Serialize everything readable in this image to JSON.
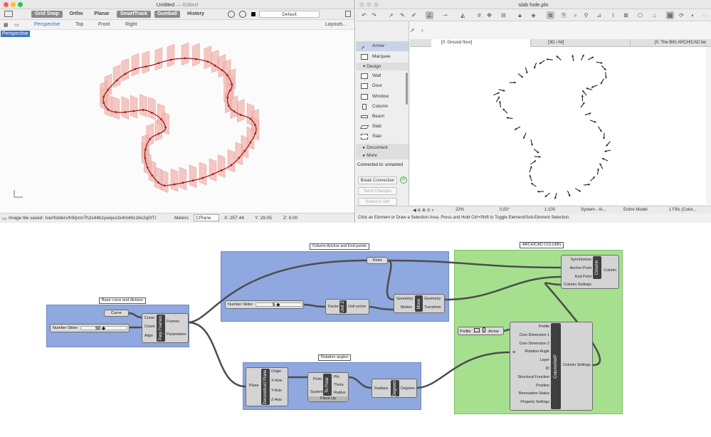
{
  "rhino": {
    "title": "Untitled",
    "title_status": "— Edited",
    "toolbar": {
      "grid_snap": "Grid Snap",
      "ortho": "Ortho",
      "planar": "Planar",
      "smarttrack": "SmartTrack",
      "gumball": "Gumball",
      "history": "History",
      "layer_default": "Default"
    },
    "tabs": [
      "Perspective",
      "Top",
      "Front",
      "Right"
    ],
    "layouts": "Layouts...",
    "viewport_label": "Perspective",
    "status": {
      "message": "Image tile saved: /var/folders/h9/prnr7h2x44b1ywqxs3x4m40c16v2q0/T/",
      "units": "Meters",
      "cplane": "CPlane",
      "x": "X: 257.44",
      "y": "Y: 29.05",
      "z": "Z: 0.00"
    }
  },
  "archicad": {
    "title": "slab hole.pln",
    "toolbox": {
      "items_top": [
        "Arrow",
        "Marquee"
      ],
      "design_header": "Design",
      "design_items": [
        "Wall",
        "Door",
        "Window",
        "Column",
        "Beam",
        "Slab",
        "Stair"
      ],
      "document_header": "Document",
      "more_header": "More"
    },
    "connection": {
      "status": "Connected to: unnamed",
      "break": "Break Connection",
      "send": "Send Changes",
      "select": "Select in GH"
    },
    "tabs": [
      "[0. Ground floor]",
      "[3D / All]",
      "[0. The BIG ARCHICAD template (The Bi..."
    ],
    "bottom": {
      "zoom": "22%",
      "angle": "0,00°",
      "scale": "1:100",
      "layer": "System - Al...",
      "model": "Entire Model",
      "fills": "1 Fills (Color..."
    },
    "status": "Click an Element or Draw a Selection Area. Press and Hold Ctrl+Shift to Toggle Element/Sub-Element Selection."
  },
  "grasshopper": {
    "groups": {
      "base": "Base curve and division",
      "anchor": "Column Anchor and End points",
      "rotation": "Rotation angles",
      "archicad": "ARCHICAD COLUMN"
    },
    "curve": "Curve",
    "slider1": {
      "label": "Number Slider",
      "value": "50 ◆"
    },
    "slider2": {
      "label": "Number Slider",
      "value": "5 ◆"
    },
    "perp": {
      "name": "Perp Frames",
      "in": [
        "Curve",
        "Count",
        "Align"
      ],
      "out": [
        "Frames",
        "Parameters"
      ]
    },
    "point": "Point",
    "unit": {
      "name": "Unit Z",
      "in": [
        "Factor"
      ],
      "out": [
        "Unit vector"
      ]
    },
    "move": {
      "name": "Move",
      "in": [
        "Geometry",
        "Motion"
      ],
      "out": [
        "Geometry",
        "Transform"
      ]
    },
    "column": {
      "name": "Column",
      "in": [
        "Synchronize",
        "Anchor Point",
        "End Point",
        "Column Settings"
      ],
      "out": [
        "Column"
      ]
    },
    "decon": {
      "name": "Deconstruct Plane",
      "in": [
        "Plane"
      ],
      "out": [
        "Origin",
        "X-Axis",
        "Y-Axis",
        "Z-Axis"
      ]
    },
    "topolar": {
      "name": "To Polar",
      "in": [
        "Point",
        "System"
      ],
      "out": [
        "Phi",
        "Theta",
        "Radius"
      ],
      "footer": "Plane Up"
    },
    "degrees": {
      "name": "Degrees",
      "in": [
        "Radians"
      ],
      "out": [
        "Degrees"
      ]
    },
    "profile": {
      "label": "Profile",
      "value": "Arrow"
    },
    "settings": {
      "name": "ColumnSetP",
      "in": [
        "Profile",
        "Core Dimension 1",
        "Core Dimension 2",
        "Rotation Angle",
        "Layer",
        "ID",
        "Structural Function",
        "Position",
        "Renovation Status",
        "Property Settings"
      ],
      "out": [
        "Column Settings"
      ]
    }
  },
  "colors": {
    "gh_blue_group": "#8fa8df",
    "gh_green_group": "#a6e08f",
    "rhino_curve": "#8a1d1d",
    "rhino_frames": "#f2b6b0",
    "accent_blue": "#3b75c4"
  }
}
